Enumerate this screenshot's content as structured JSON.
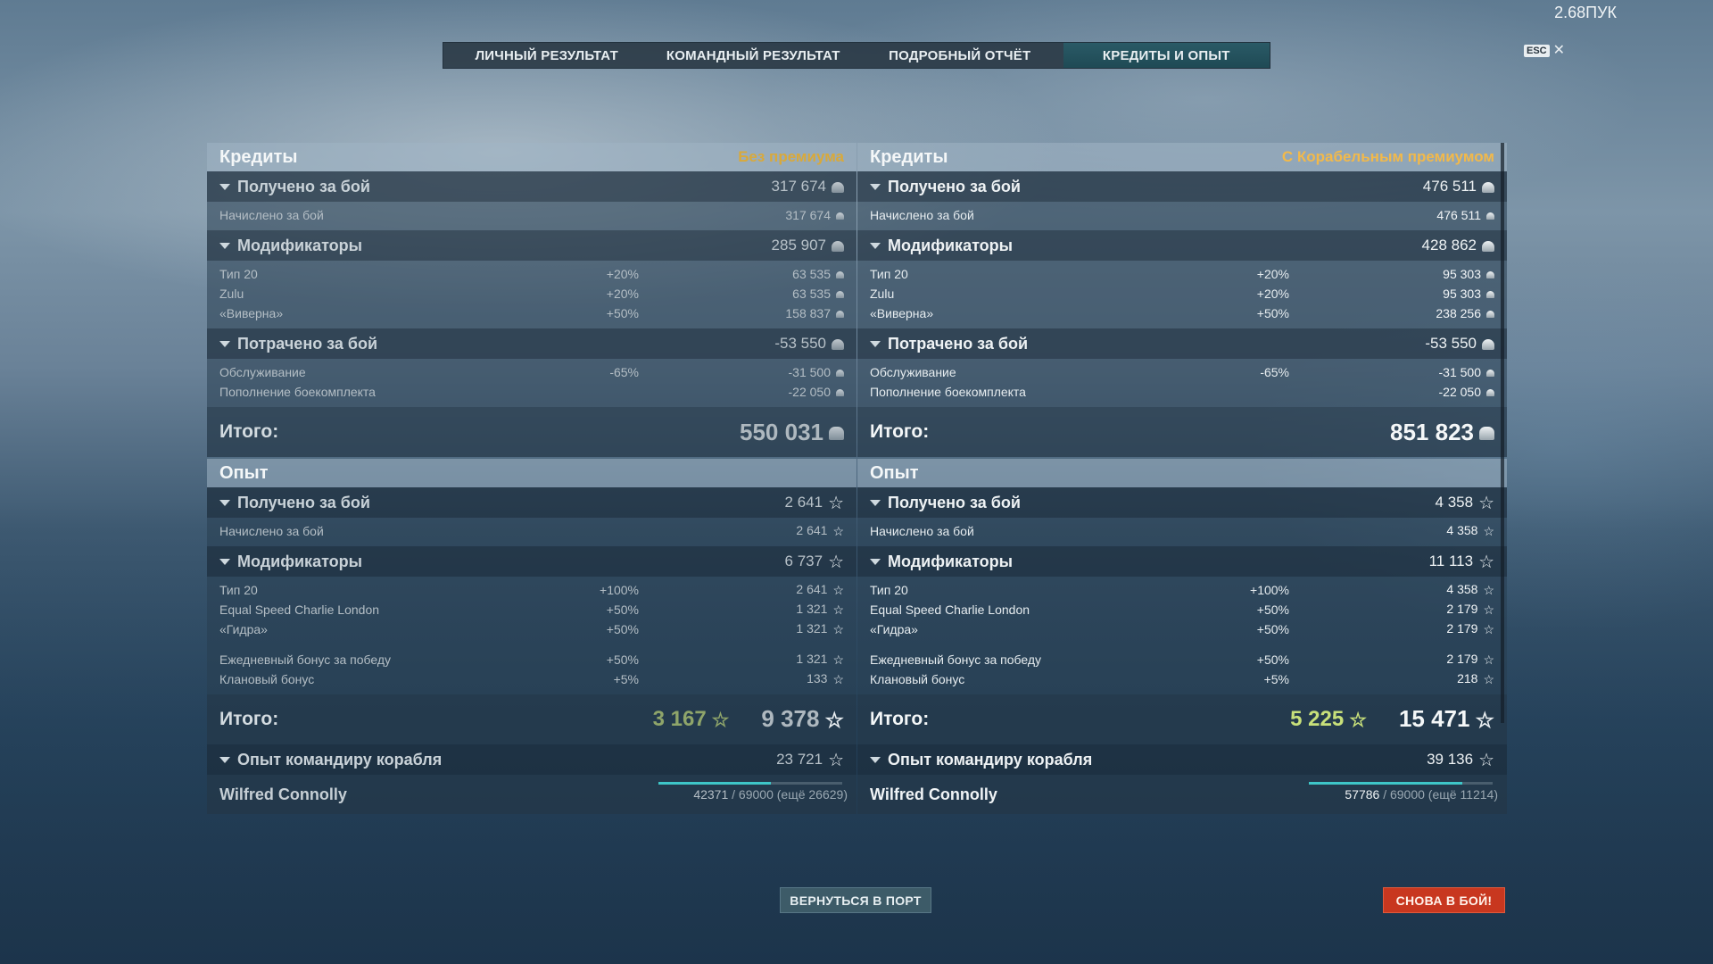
{
  "top": {
    "fps": "2.68ПУК",
    "esc_key": "ESC",
    "esc_x": "✕"
  },
  "tabs": [
    "ЛИЧНЫЙ РЕЗУЛЬТАТ",
    "КОМАНДНЫЙ РЕЗУЛЬТАТ",
    "ПОДРОБНЫЙ ОТЧЁТ",
    "КРЕДИТЫ И ОПЫТ"
  ],
  "left": {
    "credits_title": "Кредиты",
    "credits_sub": "Без премиума",
    "received_label": "Получено за бой",
    "received_value": "317 674",
    "accrued_label": "Начислено за бой",
    "accrued_value": "317 674",
    "mods_label": "Модификаторы",
    "mods_value": "285 907",
    "mods": [
      {
        "name": "Тип 20",
        "pct": "+20%",
        "value": "63 535"
      },
      {
        "name": "Zulu",
        "pct": "+20%",
        "value": "63 535"
      },
      {
        "name": "«Виверна»",
        "pct": "+50%",
        "value": "158 837"
      }
    ],
    "spent_label": "Потрачено за бой",
    "spent_value": "-53 550",
    "spent": [
      {
        "name": "Обслуживание",
        "pct": "-65%",
        "value": "-31 500"
      },
      {
        "name": "Пополнение боекомплекта",
        "pct": "",
        "value": "-22 050"
      }
    ],
    "credits_total_label": "Итого:",
    "credits_total": "550 031",
    "xp_title": "Опыт",
    "xp_received_label": "Получено за бой",
    "xp_received_value": "2 641",
    "xp_accrued_label": "Начислено за бой",
    "xp_accrued_value": "2 641",
    "xp_mods_label": "Модификаторы",
    "xp_mods_value": "6 737",
    "xp_mods": [
      {
        "name": "Тип 20",
        "pct": "+100%",
        "value": "2 641"
      },
      {
        "name": "Equal Speed Charlie London",
        "pct": "+50%",
        "value": "1 321"
      },
      {
        "name": "«Гидра»",
        "pct": "+50%",
        "value": "1 321"
      }
    ],
    "xp_bonus": [
      {
        "name": "Ежедневный бонус за победу",
        "pct": "+50%",
        "value": "1 321"
      },
      {
        "name": "Клановый бонус",
        "pct": "+5%",
        "value": "133"
      }
    ],
    "xp_total_label": "Итого:",
    "xp_total_free": "3 167",
    "xp_total": "9 378",
    "cmdr_xp_label": "Опыт командиру корабля",
    "cmdr_xp_value": "23 721",
    "cmdr_name": "Wilfred Connolly",
    "cmdr_progress_cur": "42371",
    "cmdr_progress_rest": "/ 69000 (ещё 26629)",
    "cmdr_progress_fraction": 0.614
  },
  "right": {
    "credits_title": "Кредиты",
    "credits_sub": "С Корабельным премиумом",
    "received_label": "Получено за бой",
    "received_value": "476 511",
    "accrued_label": "Начислено за бой",
    "accrued_value": "476 511",
    "mods_label": "Модификаторы",
    "mods_value": "428 862",
    "mods": [
      {
        "name": "Тип 20",
        "pct": "+20%",
        "value": "95 303"
      },
      {
        "name": "Zulu",
        "pct": "+20%",
        "value": "95 303"
      },
      {
        "name": "«Виверна»",
        "pct": "+50%",
        "value": "238 256"
      }
    ],
    "spent_label": "Потрачено за бой",
    "spent_value": "-53 550",
    "spent": [
      {
        "name": "Обслуживание",
        "pct": "-65%",
        "value": "-31 500"
      },
      {
        "name": "Пополнение боекомплекта",
        "pct": "",
        "value": "-22 050"
      }
    ],
    "credits_total_label": "Итого:",
    "credits_total": "851 823",
    "xp_title": "Опыт",
    "xp_received_label": "Получено за бой",
    "xp_received_value": "4 358",
    "xp_accrued_label": "Начислено за бой",
    "xp_accrued_value": "4 358",
    "xp_mods_label": "Модификаторы",
    "xp_mods_value": "11 113",
    "xp_mods": [
      {
        "name": "Тип 20",
        "pct": "+100%",
        "value": "4 358"
      },
      {
        "name": "Equal Speed Charlie London",
        "pct": "+50%",
        "value": "2 179"
      },
      {
        "name": "«Гидра»",
        "pct": "+50%",
        "value": "2 179"
      }
    ],
    "xp_bonus": [
      {
        "name": "Ежедневный бонус за победу",
        "pct": "+50%",
        "value": "2 179"
      },
      {
        "name": "Клановый бонус",
        "pct": "+5%",
        "value": "218"
      }
    ],
    "xp_total_label": "Итого:",
    "xp_total_free": "5 225",
    "xp_total": "15 471",
    "cmdr_xp_label": "Опыт командиру корабля",
    "cmdr_xp_value": "39 136",
    "cmdr_name": "Wilfred Connolly",
    "cmdr_progress_cur": "57786",
    "cmdr_progress_rest": "/ 69000 (ещё 11214)",
    "cmdr_progress_fraction": 0.837
  },
  "buttons": {
    "port": "ВЕРНУТЬСЯ В ПОРТ",
    "battle": "СНОВА В БОЙ!"
  },
  "icons": {
    "credit": "credit-coin-icon",
    "xp": "xp-star-icon",
    "collapse": "chevron-down-icon"
  }
}
